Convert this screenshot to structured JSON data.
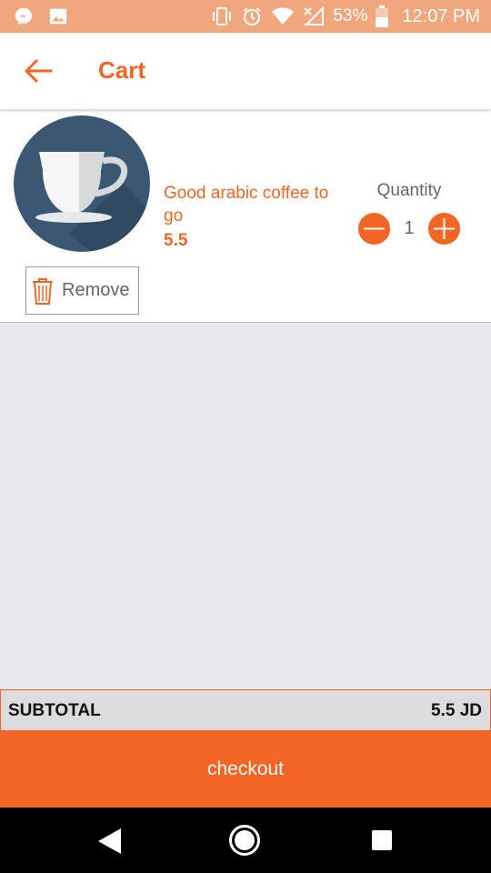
{
  "status_bar": {
    "battery": "53%",
    "time": "12:07 PM",
    "icons": [
      "messenger-icon",
      "image-icon",
      "vibrate-icon",
      "alarm-icon",
      "wifi-icon",
      "signal-icon",
      "battery-icon"
    ]
  },
  "app_bar": {
    "title": "Cart",
    "back_icon": "arrow-back-icon"
  },
  "cart": {
    "items": [
      {
        "name": "Good arabic coffee to go",
        "price": "5.5",
        "quantity_label": "Quantity",
        "quantity": "1",
        "remove_label": "Remove",
        "image_icon": "coffee-cup-icon"
      }
    ]
  },
  "summary": {
    "subtotal_label": "SUBTOTAL",
    "subtotal_value": "5.5 JD"
  },
  "checkout": {
    "label": "checkout"
  },
  "colors": {
    "accent": "#f26522",
    "status_bar": "#f0a77e",
    "background": "#e9e8ee",
    "subtotal_bg": "#dcdbe0"
  }
}
